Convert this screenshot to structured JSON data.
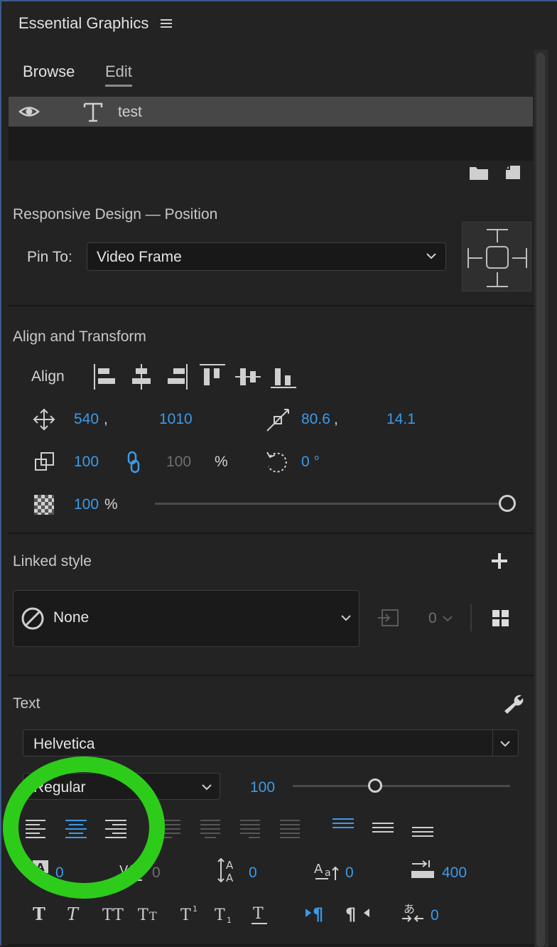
{
  "panel": {
    "title": "Essential Graphics"
  },
  "tabs": {
    "browse": "Browse",
    "edit": "Edit"
  },
  "layer": {
    "name": "test"
  },
  "responsive": {
    "title": "Responsive Design — Position",
    "pin_label": "Pin To:",
    "pin_value": "Video Frame"
  },
  "align": {
    "title": "Align and Transform",
    "align_label": "Align",
    "pos_x": "540",
    "pos_y": "1010",
    "anchor_x": "80.6",
    "anchor_y": "14.1",
    "scale": "100",
    "scale_h": "100",
    "percent": "%",
    "rotation": "0 °",
    "opacity": "100",
    "opacity_unit": "%",
    "opacity_fraction": 1.0,
    "comma": ","
  },
  "linked_style": {
    "title": "Linked style",
    "value": "None",
    "count": "0"
  },
  "text": {
    "title": "Text",
    "font": "Helvetica",
    "style": "Regular",
    "size": "100",
    "size_fraction": 0.38,
    "kerning": "0",
    "tracking": "0",
    "leading": "0",
    "baseline": "0",
    "tab_width": "400",
    "tsume": "0"
  },
  "colors": {
    "accent": "#3d9ae8",
    "highlight_ring": "#2ecc1a"
  }
}
